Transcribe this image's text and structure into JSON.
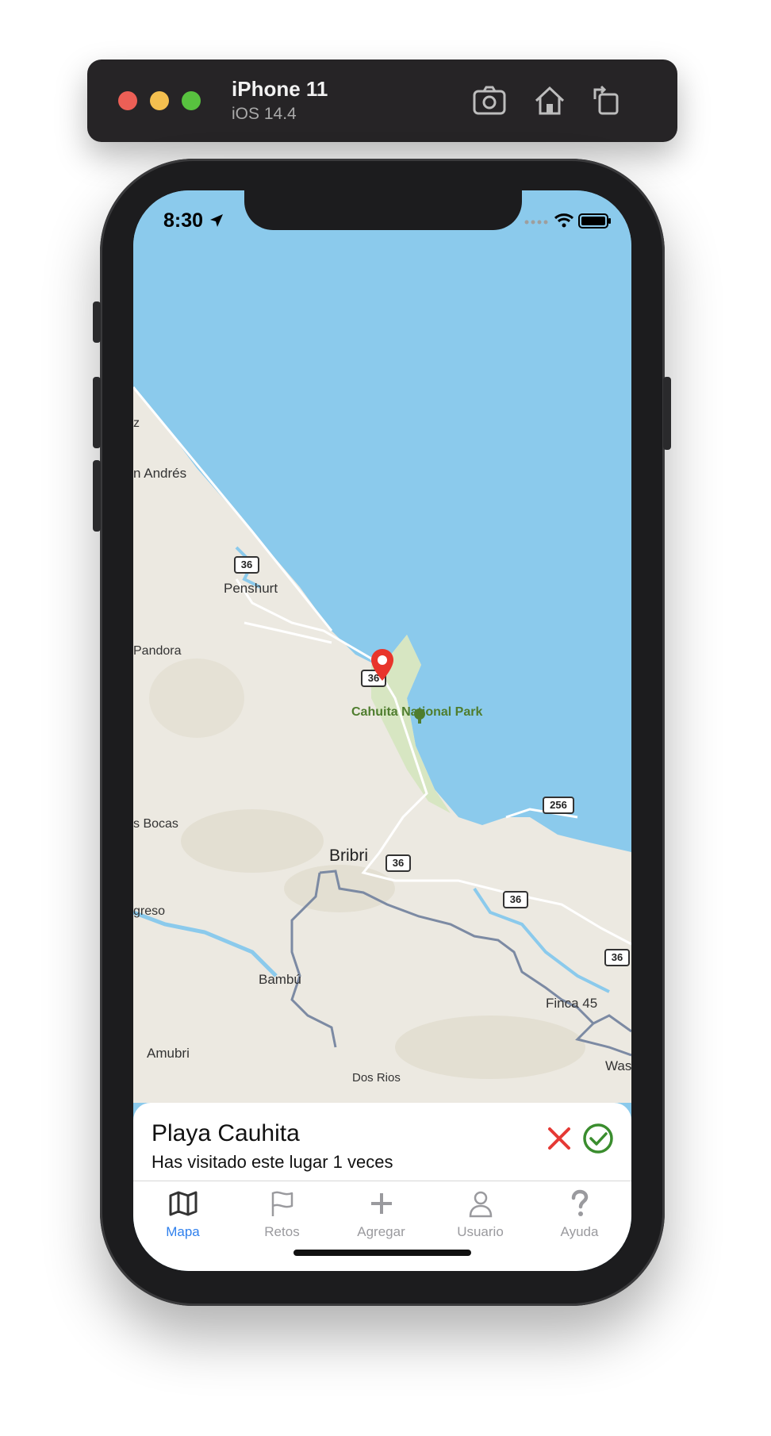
{
  "simulator": {
    "device_name": "iPhone 11",
    "os_version": "iOS 14.4",
    "tools": [
      "screenshot-icon",
      "home-icon",
      "rotate-icon"
    ]
  },
  "status_bar": {
    "time": "8:30"
  },
  "map": {
    "labels": {
      "san_andres": "n Andrés",
      "penshurt": "Penshurt",
      "pandora": "Pandora",
      "cahuita": "Cahuita National Park",
      "bocas": "s Bocas",
      "bribri": "Bribri",
      "progreso": "greso",
      "bambu": "Bambú",
      "amubri": "Amubri",
      "dos_rios": "Dos Rios",
      "finca45": "Finca 45",
      "was": "Was",
      "z": "z"
    },
    "route_shields": [
      "36",
      "36",
      "36",
      "36",
      "36",
      "256"
    ]
  },
  "place_card": {
    "title": "Playa Cauhita",
    "subtitle": "Has visitado este lugar 1 veces"
  },
  "tabs": [
    {
      "label": "Mapa",
      "icon": "map-icon",
      "active": true
    },
    {
      "label": "Retos",
      "icon": "flag-icon",
      "active": false
    },
    {
      "label": "Agregar",
      "icon": "plus-icon",
      "active": false
    },
    {
      "label": "Usuario",
      "icon": "user-icon",
      "active": false
    },
    {
      "label": "Ayuda",
      "icon": "question-icon",
      "active": false
    }
  ],
  "colors": {
    "sea": "#8bcaec",
    "land": "#ece9e1",
    "park": "#d7e6c2",
    "pin": "#e8352b",
    "accent": "#2f80ed",
    "reject": "#e53935",
    "accept": "#3a8d2e"
  }
}
